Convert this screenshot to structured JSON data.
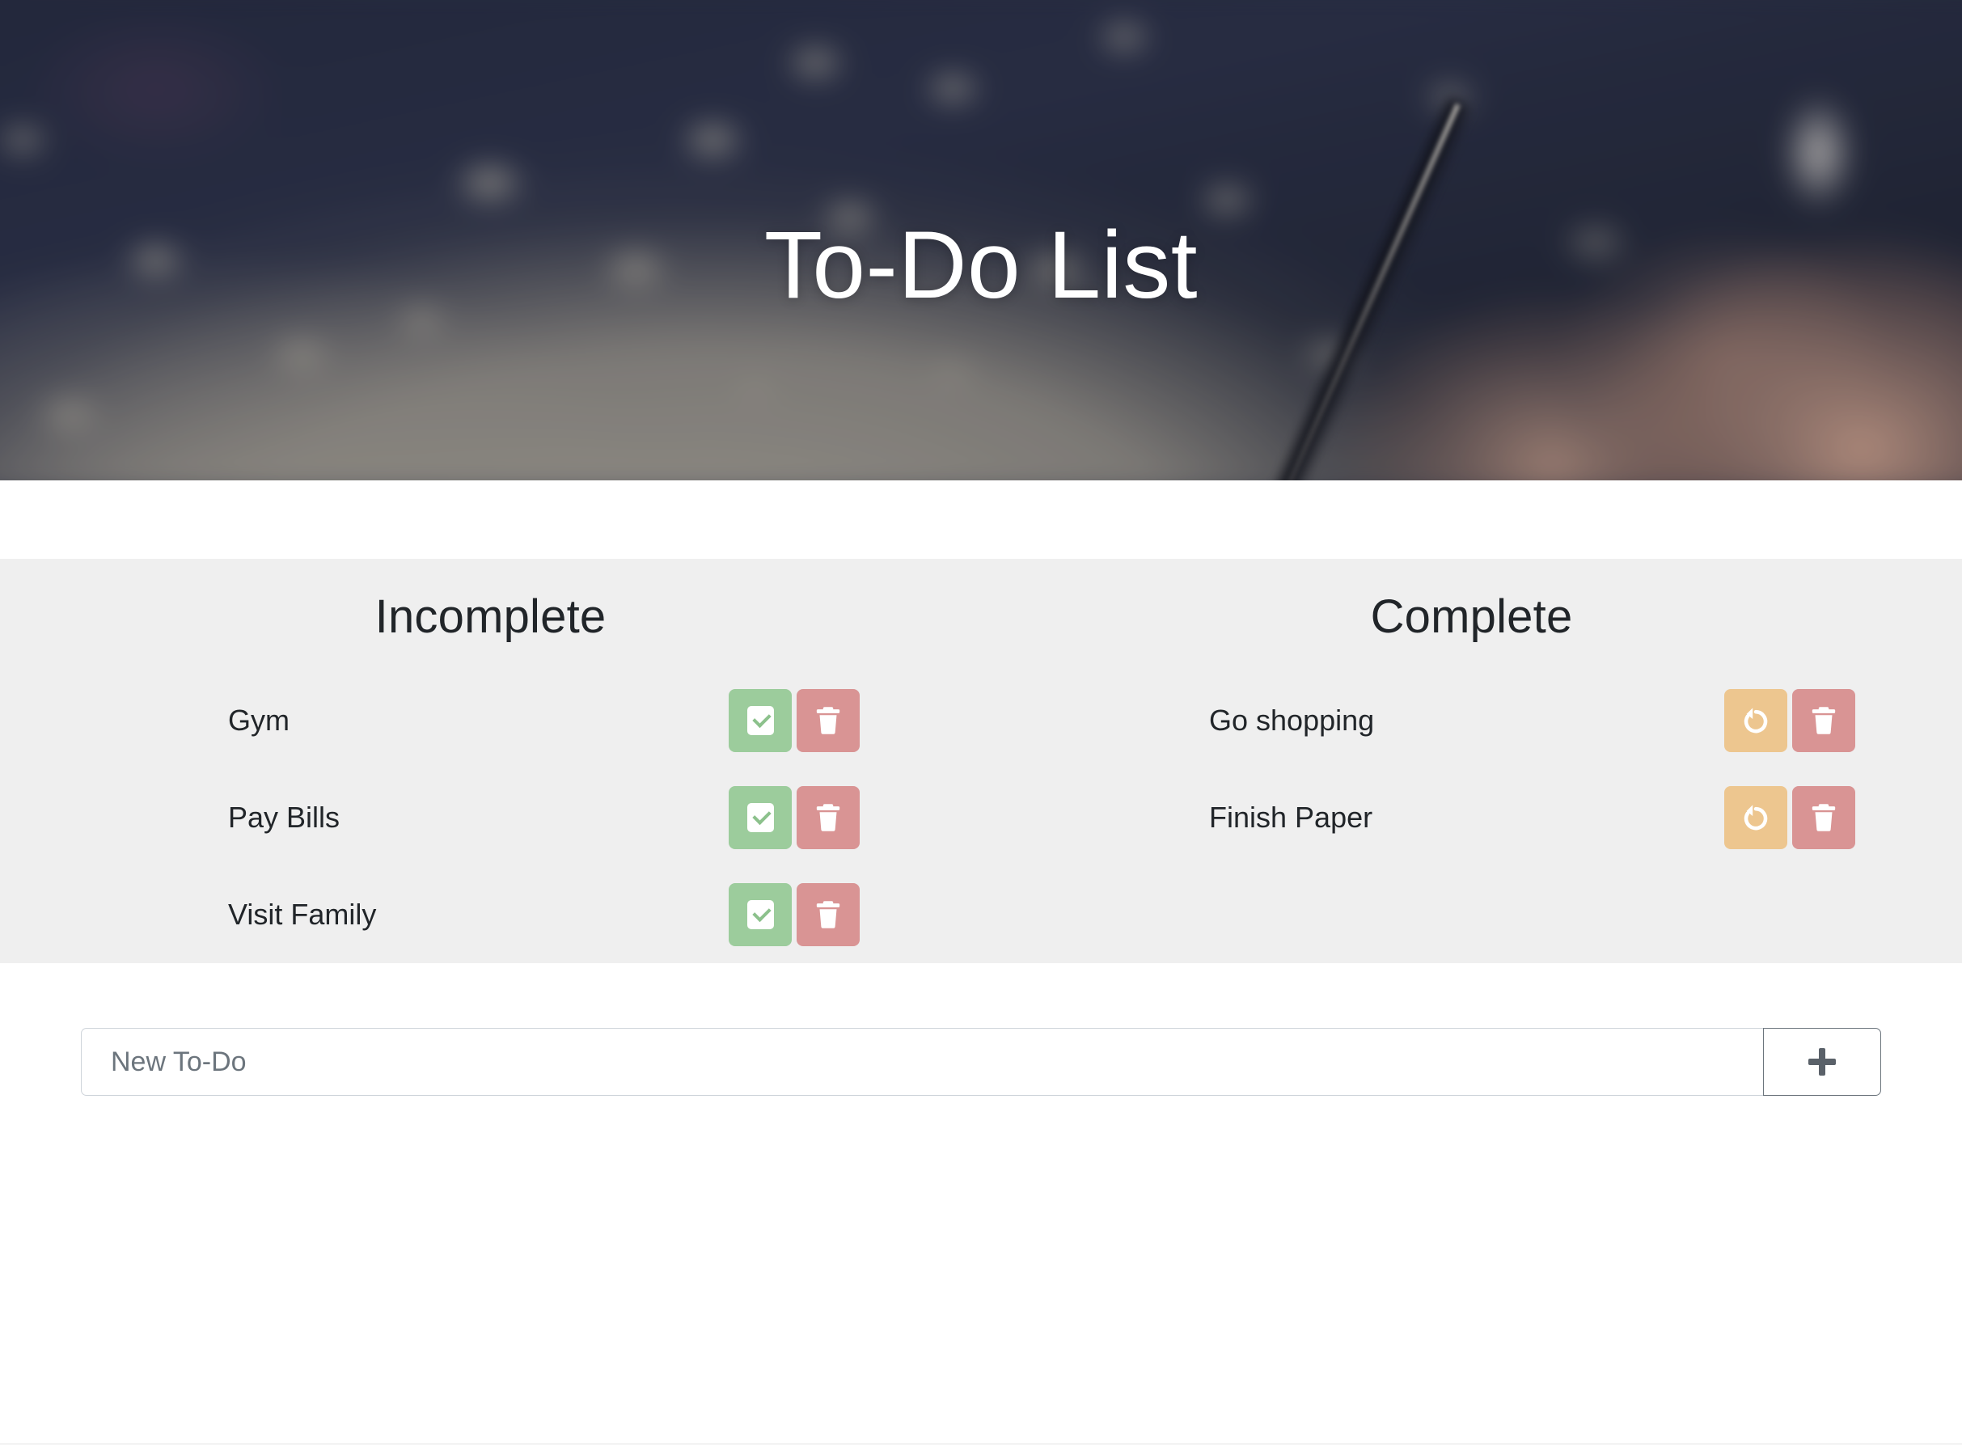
{
  "header": {
    "title": "To-Do List",
    "background_image_description": "blurred navy polka-dot fabric and a hand writing with a pen on a notebook"
  },
  "colors": {
    "panel_background": "#efefef",
    "page_background": "#ffffff",
    "heading_text": "#212529",
    "item_text": "#212529",
    "complete_button": "#9ccc9c",
    "undo_button": "#edc68f",
    "delete_button": "#d99494",
    "icon_white": "#ffffff",
    "input_border": "#ced4da",
    "add_button_border": "#6c757d",
    "placeholder_text": "#6c757d"
  },
  "columns": [
    {
      "id": "incomplete",
      "heading": "Incomplete",
      "items": [
        {
          "label": "Gym",
          "actions": [
            {
              "name": "complete",
              "icon": "check-square-icon"
            },
            {
              "name": "delete",
              "icon": "trash-icon"
            }
          ]
        },
        {
          "label": "Pay Bills",
          "actions": [
            {
              "name": "complete",
              "icon": "check-square-icon"
            },
            {
              "name": "delete",
              "icon": "trash-icon"
            }
          ]
        },
        {
          "label": "Visit Family",
          "actions": [
            {
              "name": "complete",
              "icon": "check-square-icon"
            },
            {
              "name": "delete",
              "icon": "trash-icon"
            }
          ]
        }
      ]
    },
    {
      "id": "complete",
      "heading": "Complete",
      "items": [
        {
          "label": "Go shopping",
          "actions": [
            {
              "name": "undo",
              "icon": "undo-arrow-icon"
            },
            {
              "name": "delete",
              "icon": "trash-icon"
            }
          ]
        },
        {
          "label": "Finish Paper",
          "actions": [
            {
              "name": "undo",
              "icon": "undo-arrow-icon"
            },
            {
              "name": "delete",
              "icon": "trash-icon"
            }
          ]
        }
      ]
    }
  ],
  "add_form": {
    "input_placeholder": "New To-Do",
    "input_value": "",
    "add_button_icon": "plus-icon",
    "add_button_label": "+"
  }
}
